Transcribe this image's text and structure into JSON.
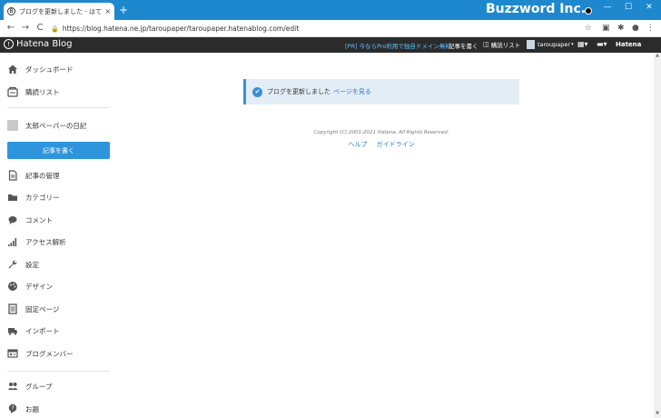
{
  "browser": {
    "tab_title": "ブログを更新しました - はてなブログ",
    "tab_close": "×",
    "new_tab": "+",
    "brand_overlay": "Buzzword Inc.",
    "url": "https://blog.hatena.ne.jp/taroupaper/taroupaper.hatenablog.com/edit",
    "window_controls": {
      "minimize": "—",
      "maximize": "☐",
      "close": "✕"
    },
    "nav": {
      "back": "←",
      "forward": "→",
      "reload": "C"
    }
  },
  "header": {
    "logo": "Hatena Blog",
    "promo": "[PR] 今ならPro利用で独自ドメイン無料",
    "write": "記事を書く",
    "read_list": "購読リスト",
    "username": "taroupaper",
    "hatena": "Hatena"
  },
  "sidebar": {
    "dashboard": "ダッシュボード",
    "reading_list": "購読リスト",
    "blog_name": "太郎ペーパーの日記",
    "write_button": "記事を書く",
    "items": [
      {
        "label": "記事の管理",
        "icon": "document-icon"
      },
      {
        "label": "カテゴリー",
        "icon": "folder-icon"
      },
      {
        "label": "コメント",
        "icon": "comment-icon"
      },
      {
        "label": "アクセス解析",
        "icon": "signal-icon"
      },
      {
        "label": "設定",
        "icon": "wrench-icon"
      },
      {
        "label": "デザイン",
        "icon": "palette-icon"
      },
      {
        "label": "固定ページ",
        "icon": "pages-icon"
      },
      {
        "label": "インポート",
        "icon": "truck-icon"
      },
      {
        "label": "ブログメンバー",
        "icon": "members-icon"
      }
    ],
    "group": "グループ",
    "help": "お題"
  },
  "main": {
    "notice_text": "ブログを更新しました",
    "notice_link": "ページを見る",
    "copyright": "Copyright (C) 2001-2021 Hatena. All Rights Reserved.",
    "footer_help": "ヘルプ",
    "footer_guideline": "ガイドライン"
  },
  "colors": {
    "chrome_blue": "#1e88cf",
    "header_dark": "#2b2b2b",
    "accent_blue": "#2e95dd",
    "notice_bg": "#e3edf5"
  }
}
